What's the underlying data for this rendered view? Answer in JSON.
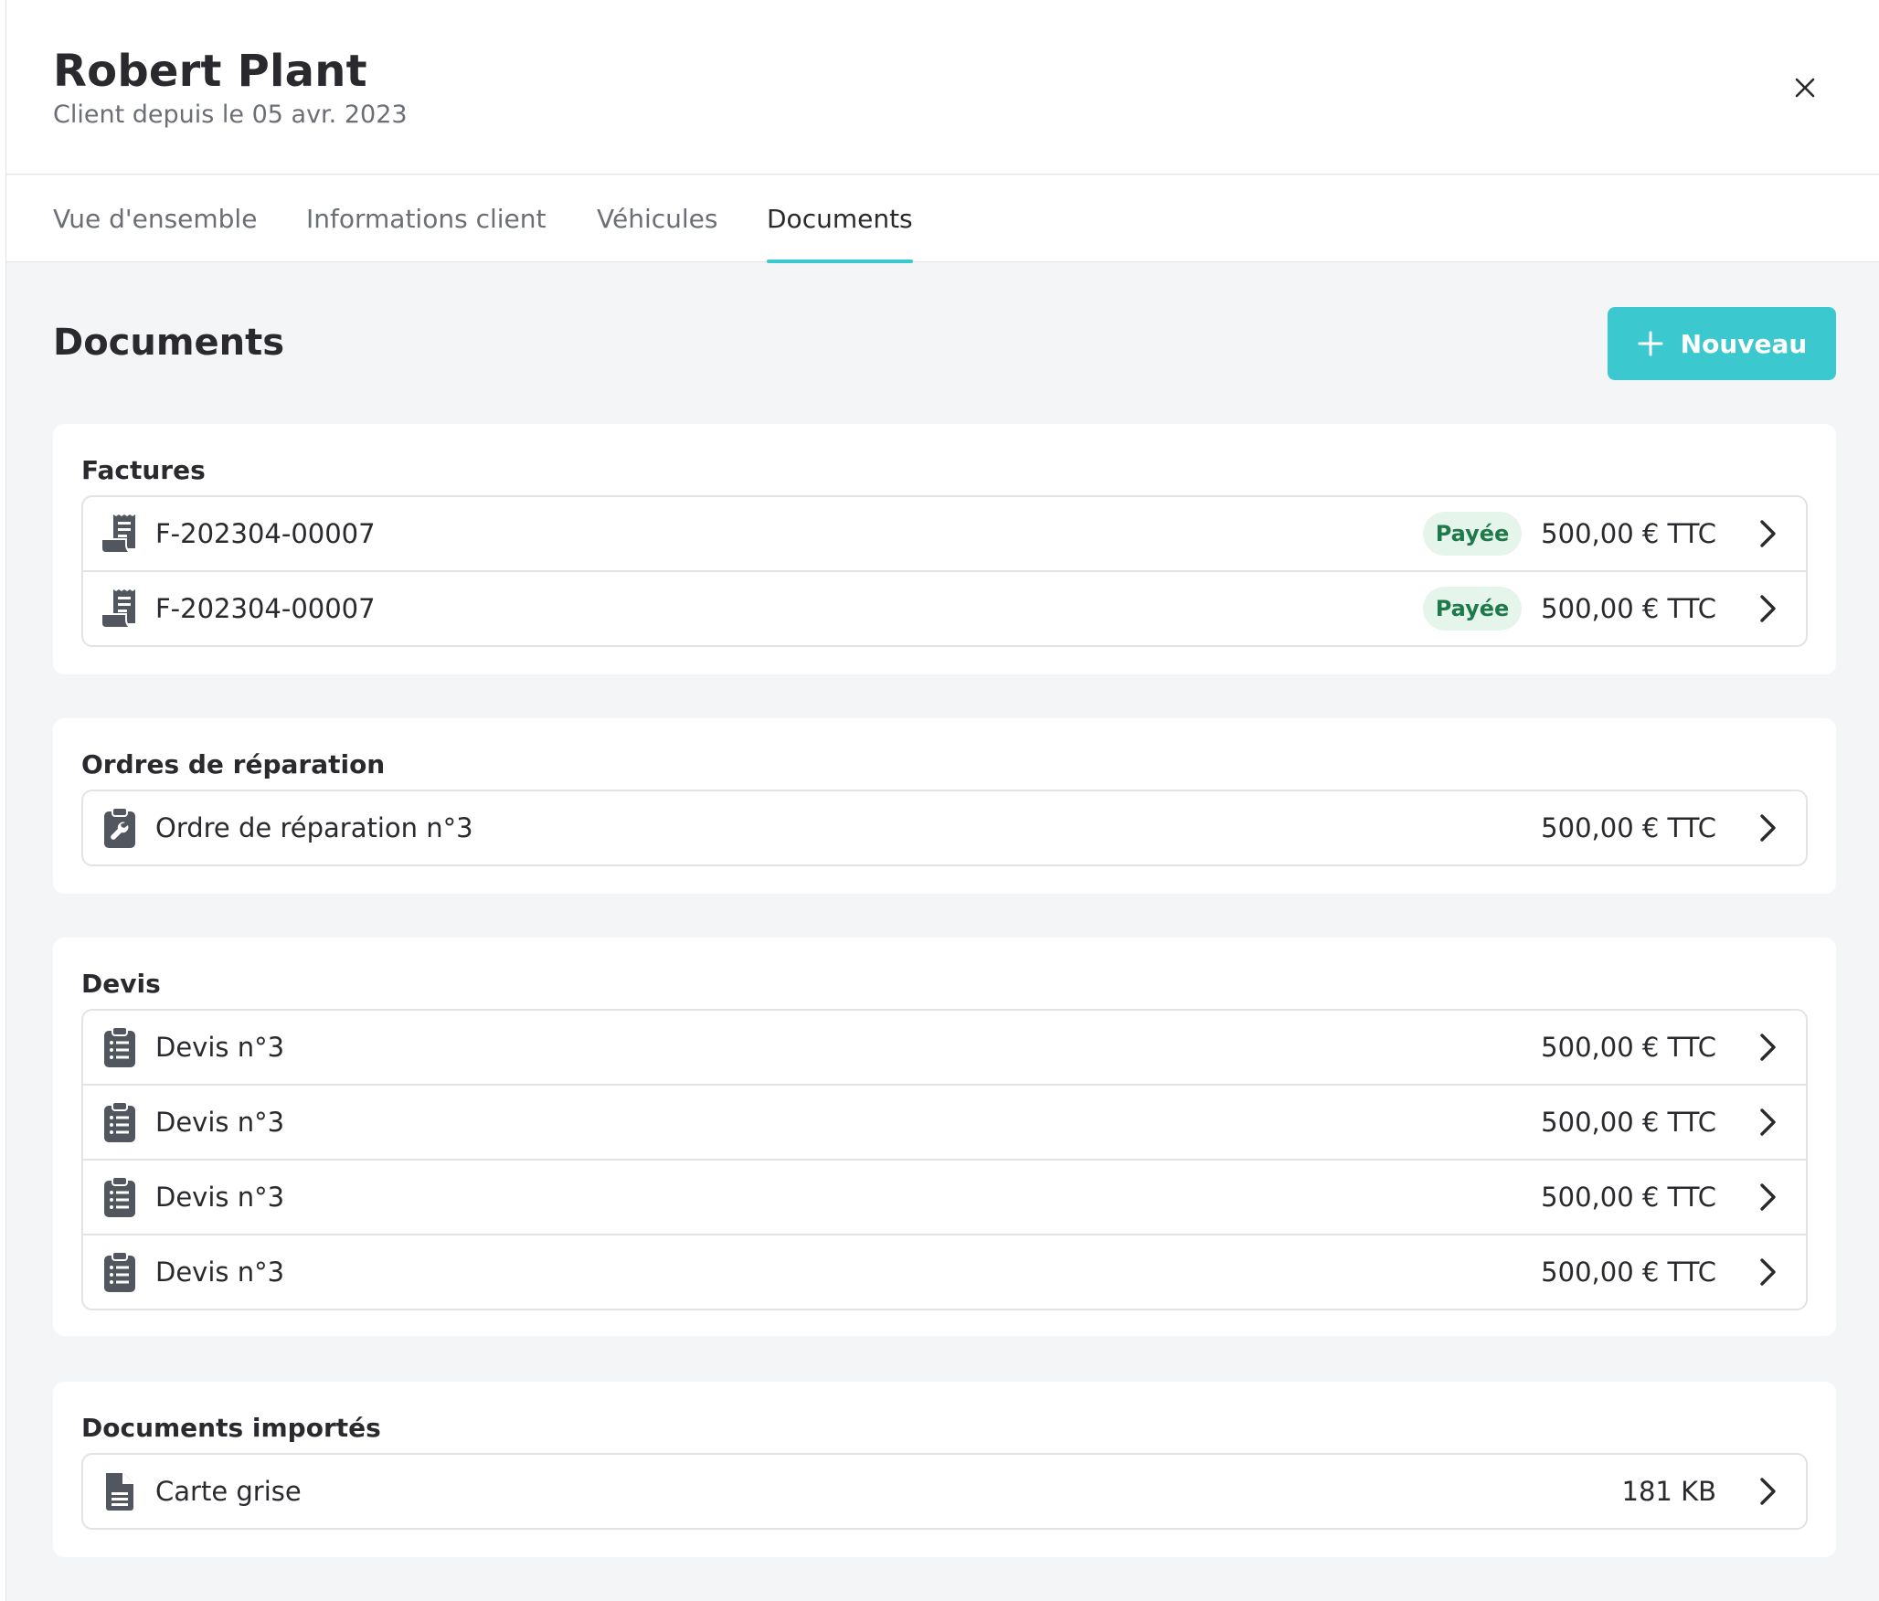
{
  "header": {
    "name": "Robert Plant",
    "subtitle": "Client depuis le 05 avr. 2023"
  },
  "tabs": [
    {
      "label": "Vue d'ensemble",
      "active": false
    },
    {
      "label": "Informations client",
      "active": false
    },
    {
      "label": "Véhicules",
      "active": false
    },
    {
      "label": "Documents",
      "active": true
    }
  ],
  "main": {
    "title": "Documents",
    "new_button_label": "Nouveau"
  },
  "colors": {
    "accent": "#3cc8cf",
    "badge_bg": "#e5f5ec",
    "badge_text": "#1e7a4a",
    "icon": "#52565e"
  },
  "sections": [
    {
      "title": "Factures",
      "icon": "receipt-icon",
      "items": [
        {
          "label": "F-202304-00007",
          "status": "Payée",
          "amount": "500,00 € TTC"
        },
        {
          "label": "F-202304-00007",
          "status": "Payée",
          "amount": "500,00 € TTC"
        }
      ]
    },
    {
      "title": "Ordres de réparation",
      "icon": "clipboard-wrench-icon",
      "items": [
        {
          "label": "Ordre de réparation n°3",
          "amount": "500,00 € TTC"
        }
      ]
    },
    {
      "title": "Devis",
      "icon": "clipboard-list-icon",
      "items": [
        {
          "label": "Devis n°3",
          "amount": "500,00 € TTC"
        },
        {
          "label": "Devis n°3",
          "amount": "500,00 € TTC"
        },
        {
          "label": "Devis n°3",
          "amount": "500,00 € TTC"
        },
        {
          "label": "Devis n°3",
          "amount": "500,00 € TTC"
        }
      ]
    },
    {
      "title": "Documents importés",
      "icon": "file-lines-icon",
      "items": [
        {
          "label": "Carte grise",
          "amount": "181 KB"
        }
      ]
    }
  ]
}
